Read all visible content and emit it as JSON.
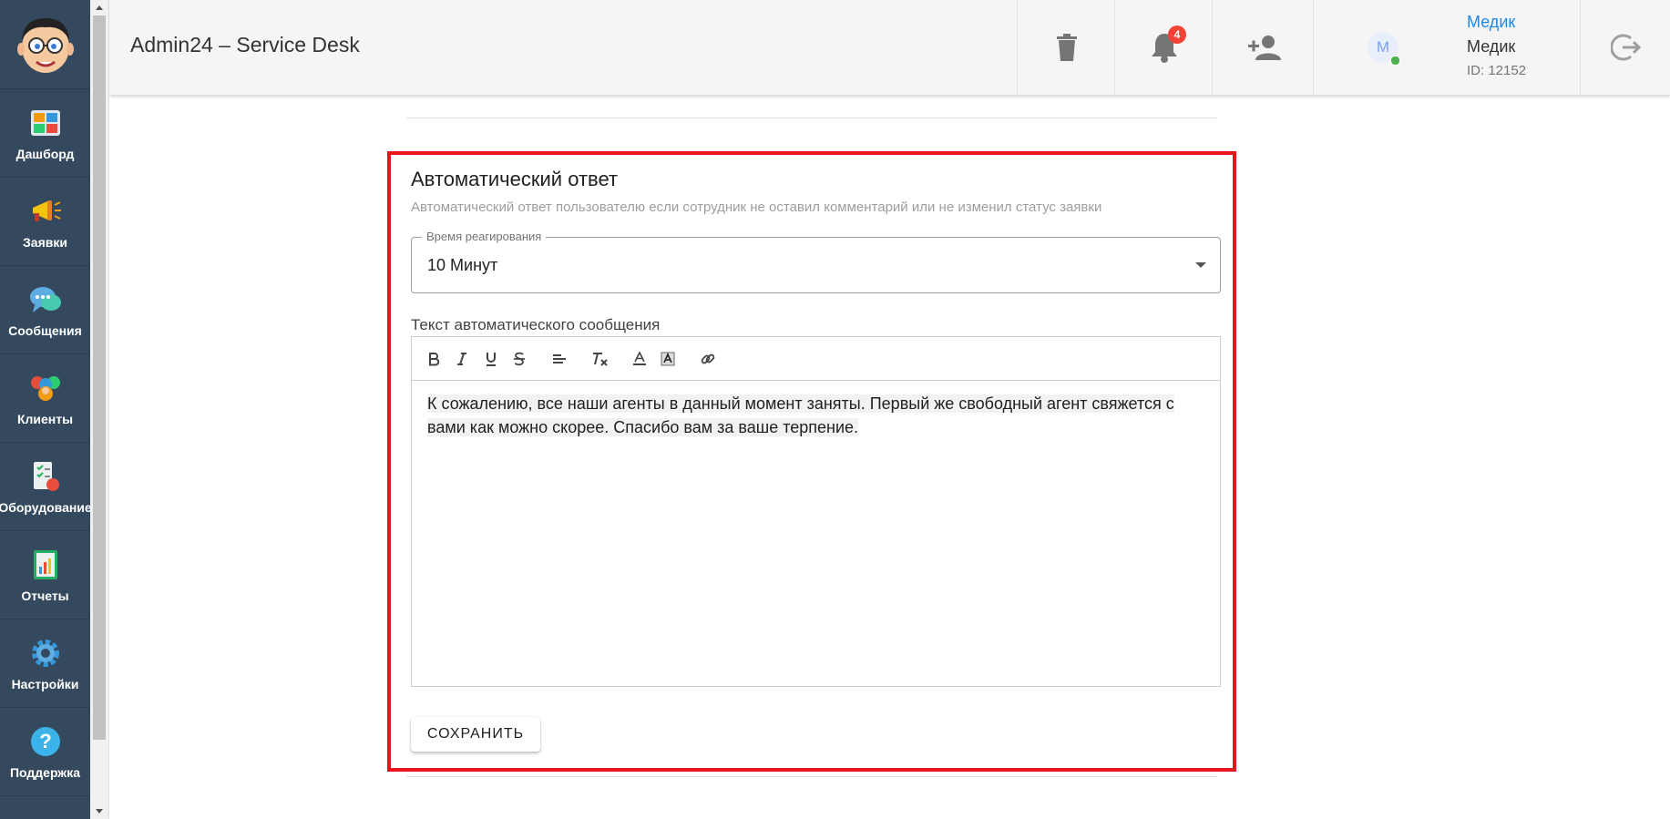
{
  "header": {
    "title": "Admin24 – Service Desk",
    "notifications_count": "4",
    "user": {
      "avatar_initial": "M",
      "name_link": "Медик",
      "name": "Медик",
      "id": "ID: 12152"
    }
  },
  "sidebar": {
    "items": [
      {
        "label": "Дашборд",
        "icon": "dashboard-icon"
      },
      {
        "label": "Заявки",
        "icon": "megaphone-icon"
      },
      {
        "label": "Сообщения",
        "icon": "chat-icon"
      },
      {
        "label": "Клиенты",
        "icon": "clients-icon"
      },
      {
        "label": "Оборудование",
        "icon": "equipment-icon"
      },
      {
        "label": "Отчеты",
        "icon": "reports-icon"
      },
      {
        "label": "Настройки",
        "icon": "gear-icon"
      },
      {
        "label": "Поддержка",
        "icon": "help-icon"
      }
    ]
  },
  "card": {
    "title": "Автоматический ответ",
    "subtitle": "Автоматический ответ пользователю если сотрудник не оставил комментарий или не изменил статус заявки",
    "select": {
      "label": "Время реагирования",
      "value": "10 Минут"
    },
    "editor": {
      "label": "Текст автоматического сообщения",
      "text": "К сожалению, все наши агенты в данный момент заняты. Первый же свободный агент свяжется с вами как можно скорее. Спасибо вам за ваше терпение."
    },
    "save_label": "СОХРАНИТЬ"
  },
  "colors": {
    "sidebar_bg": "#34495e",
    "highlight_border": "#e8141c",
    "badge": "#f44336",
    "link": "#1e88e5",
    "online": "#4caf50"
  }
}
